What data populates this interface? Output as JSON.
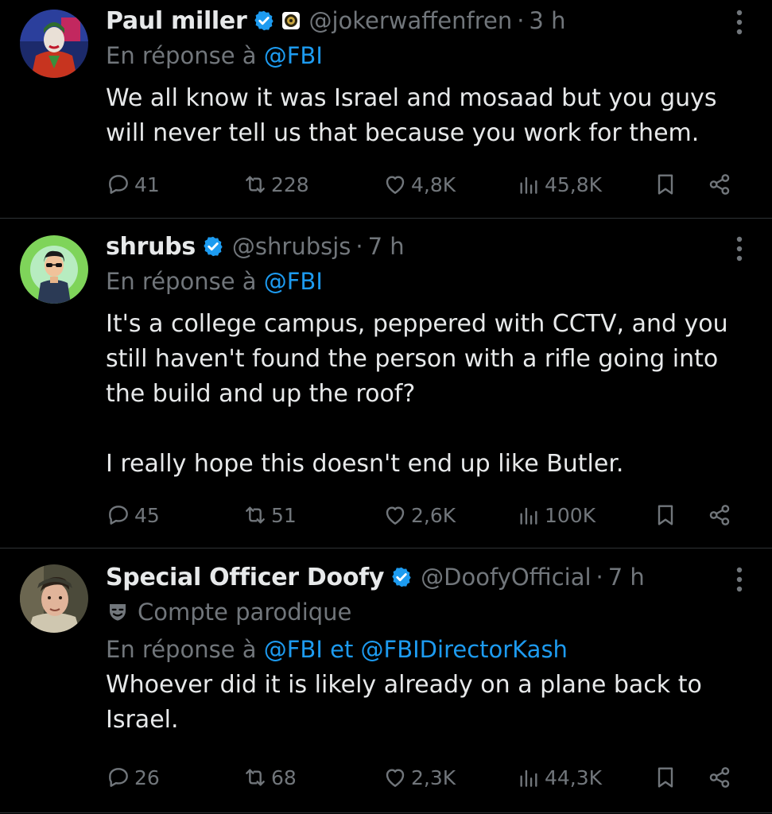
{
  "tweets": [
    {
      "name": "Paul miller",
      "handle": "@jokerwaffenfren",
      "sep": "·",
      "time": "3 h",
      "reply_prefix": "En réponse à",
      "reply_mentions": [
        "@FBI"
      ],
      "reply_joiner": "",
      "paragraphs": [
        "We all know it was Israel and mosaad but you guys will never tell us that because you work for them."
      ],
      "replies": "41",
      "reposts": "228",
      "likes": "4,8K",
      "views": "45,8K"
    },
    {
      "name": "shrubs",
      "handle": "@shrubsjs",
      "sep": "·",
      "time": "7 h",
      "reply_prefix": "En réponse à",
      "reply_mentions": [
        "@FBI"
      ],
      "reply_joiner": "",
      "paragraphs": [
        "It's a college campus, peppered with CCTV, and you still haven't found the person with a rifle going into the build and up the roof?",
        "I really hope this doesn't end up like Butler."
      ],
      "replies": "45",
      "reposts": "51",
      "likes": "2,6K",
      "views": "100K"
    },
    {
      "name": "Special Officer Doofy",
      "handle": "@DoofyOfficial",
      "sep": "·",
      "time": "7 h",
      "parody_label": "Compte parodique",
      "reply_prefix": "En réponse à",
      "reply_mentions": [
        "@FBI",
        "@FBIDirectorKash"
      ],
      "reply_joiner": "et",
      "paragraphs": [
        "Whoever did it is likely already on a plane back to Israel."
      ],
      "replies": "26",
      "reposts": "68",
      "likes": "2,3K",
      "views": "44,3K"
    }
  ],
  "colors": {
    "background": "#000000",
    "text": "#e7e9ea",
    "muted": "#71767b",
    "accent": "#1d9bf0",
    "divider": "#2f3336"
  },
  "icons": {
    "verified": "verified-badge-icon",
    "affiliation": "affiliation-badge-icon",
    "parody": "parody-mask-icon",
    "more": "more-options-icon",
    "reply": "reply-bubble-icon",
    "repost": "repost-arrows-icon",
    "like": "heart-icon",
    "views": "views-chart-icon",
    "bookmark": "bookmark-icon",
    "share": "share-icon"
  }
}
